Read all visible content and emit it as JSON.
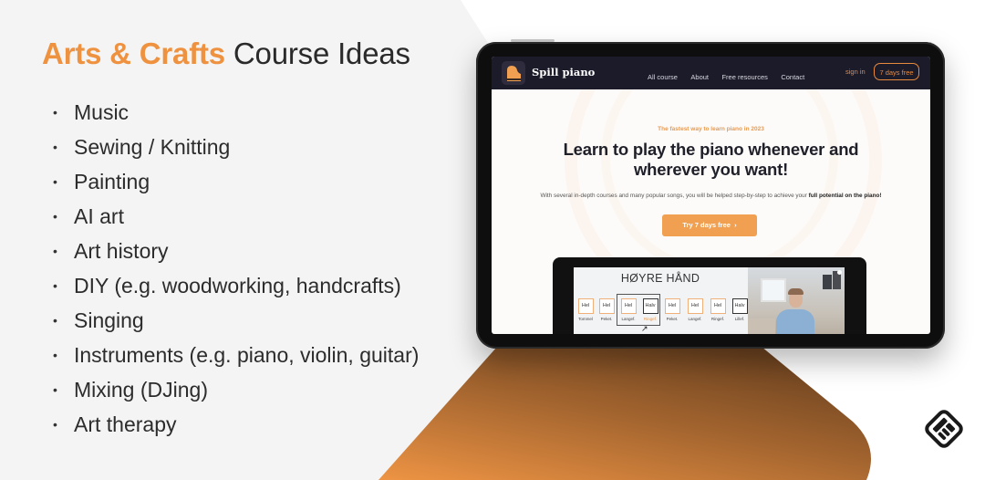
{
  "colors": {
    "accent": "#ef9240",
    "heading": "#2a2a2a",
    "navbar_bg": "#1c1b2a",
    "cta_bg": "#f0a050",
    "orange_shape_start": "#ee9444",
    "orange_shape_end": "#7a4a22"
  },
  "slide": {
    "title_accent": "Arts & Crafts",
    "title_rest": " Course Ideas",
    "bullet_glyph": "•",
    "ideas": [
      "Music",
      "Sewing / Knitting",
      "Painting",
      "AI art",
      "Art history",
      "DIY (e.g. woodworking, handcrafts)",
      "Singing",
      "Instruments (e.g. piano, violin, guitar)",
      "Mixing (DJing)",
      "Art therapy"
    ]
  },
  "website": {
    "brand": "Spill piano",
    "logo_icon": "grand-piano-icon",
    "nav": [
      "All course",
      "About",
      "Free resources",
      "Contact"
    ],
    "sign_in": "sign in",
    "trial_button": "7 days free",
    "kicker": "The fastest way to learn piano in 2023",
    "headline_line1": "Learn to play the piano whenever and",
    "headline_line2": "wherever you want!",
    "subtext": "With several in-depth courses and many popular songs, you will be helped step-by-step to achieve your ",
    "subtext_bold": "full potential on the piano!",
    "cta": "Try 7 days free",
    "cta_icon": "chevron-right-icon",
    "cta_chevron": "›",
    "lesson": {
      "title": "HØYRE HÅND",
      "notes": [
        {
          "value": "Hel",
          "finger": "Tommel",
          "style": "light",
          "highlight": false
        },
        {
          "value": "Hel",
          "finger": "Peket.",
          "style": "light",
          "highlight": false
        },
        {
          "value": "Hel",
          "finger": "Langef.",
          "style": "light",
          "highlight": false
        },
        {
          "value": "Halv",
          "finger": "Ringef.",
          "style": "dark",
          "highlight": true
        },
        {
          "value": "Hel",
          "finger": "Peket.",
          "style": "light",
          "highlight": false
        },
        {
          "value": "Hel",
          "finger": "Langef.",
          "style": "light",
          "highlight": false
        },
        {
          "value": "Hel",
          "finger": "Ringef.",
          "style": "light",
          "highlight": false
        },
        {
          "value": "Halv",
          "finger": "Lillef.",
          "style": "dark",
          "highlight": false
        }
      ],
      "pointer_glyph": "↗"
    }
  },
  "corner_logo": "brand-mark-icon"
}
